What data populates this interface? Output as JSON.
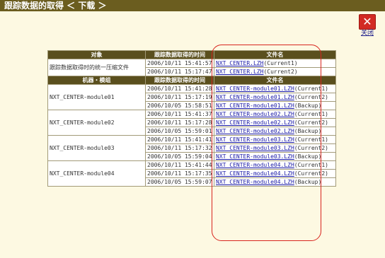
{
  "window": {
    "title": "跟踪数据的取得 ＜ 下载 ＞"
  },
  "close": {
    "label": "关闭",
    "icon": "close-icon"
  },
  "table": {
    "header1": [
      "对象",
      "跟踪数据取得的时间",
      "文件名"
    ],
    "summary_row": {
      "label": "跟踪数据取得时的统一压缩文件",
      "entries": [
        {
          "time": "2006/10/11 15:41:57",
          "file": "NXT_CENTER.LZH",
          "note": "(Current1)"
        },
        {
          "time": "2006/10/11 15:17:47",
          "file": "NXT_CENTER.LZH",
          "note": "(Current2)"
        }
      ]
    },
    "header2": [
      "机器・模组",
      "跟踪数据取得的时间",
      "文件名"
    ],
    "modules": [
      {
        "name": "NXT_CENTER-module01",
        "entries": [
          {
            "time": "2006/10/11 15:41:28",
            "file": "NXT_CENTER-module01.LZH",
            "note": "(Current1)"
          },
          {
            "time": "2006/10/11 15:17:19",
            "file": "NXT_CENTER-module01.LZH",
            "note": "(Current2)"
          },
          {
            "time": "2006/10/05 15:58:51",
            "file": "NXT_CENTER-module01.LZH",
            "note": "(Backup)"
          }
        ]
      },
      {
        "name": "NXT_CENTER-module02",
        "entries": [
          {
            "time": "2006/10/11 15:41:37",
            "file": "NXT_CENTER-module02.LZH",
            "note": "(Current1)"
          },
          {
            "time": "2006/10/11 15:17:28",
            "file": "NXT_CENTER-module02.LZH",
            "note": "(Current2)"
          },
          {
            "time": "2006/10/05 15:59:01",
            "file": "NXT_CENTER-module02.LZH",
            "note": "(Backup)"
          }
        ]
      },
      {
        "name": "NXT_CENTER-module03",
        "entries": [
          {
            "time": "2006/10/11 15:41:41",
            "file": "NXT_CENTER-module03.LZH",
            "note": "(Current1)"
          },
          {
            "time": "2006/10/11 15:17:32",
            "file": "NXT_CENTER-module03.LZH",
            "note": "(Current2)"
          },
          {
            "time": "2006/10/05 15:59:04",
            "file": "NXT_CENTER-module03.LZH",
            "note": "(Backup)"
          }
        ]
      },
      {
        "name": "NXT_CENTER-module04",
        "entries": [
          {
            "time": "2006/10/11 15:41:44",
            "file": "NXT_CENTER-module04.LZH",
            "note": "(Current1)"
          },
          {
            "time": "2006/10/11 15:17:35",
            "file": "NXT_CENTER-module04.LZH",
            "note": "(Current2)"
          },
          {
            "time": "2006/10/05 15:59:07",
            "file": "NXT_CENTER-module04.LZH",
            "note": "(Backup)"
          }
        ]
      }
    ]
  },
  "colors": {
    "titlebar": "#6b5d1f",
    "header_bg": "#5a4f1e",
    "page_bg": "#fdf9e2",
    "highlight": "#d8251f",
    "close_bg": "#d22b24"
  }
}
